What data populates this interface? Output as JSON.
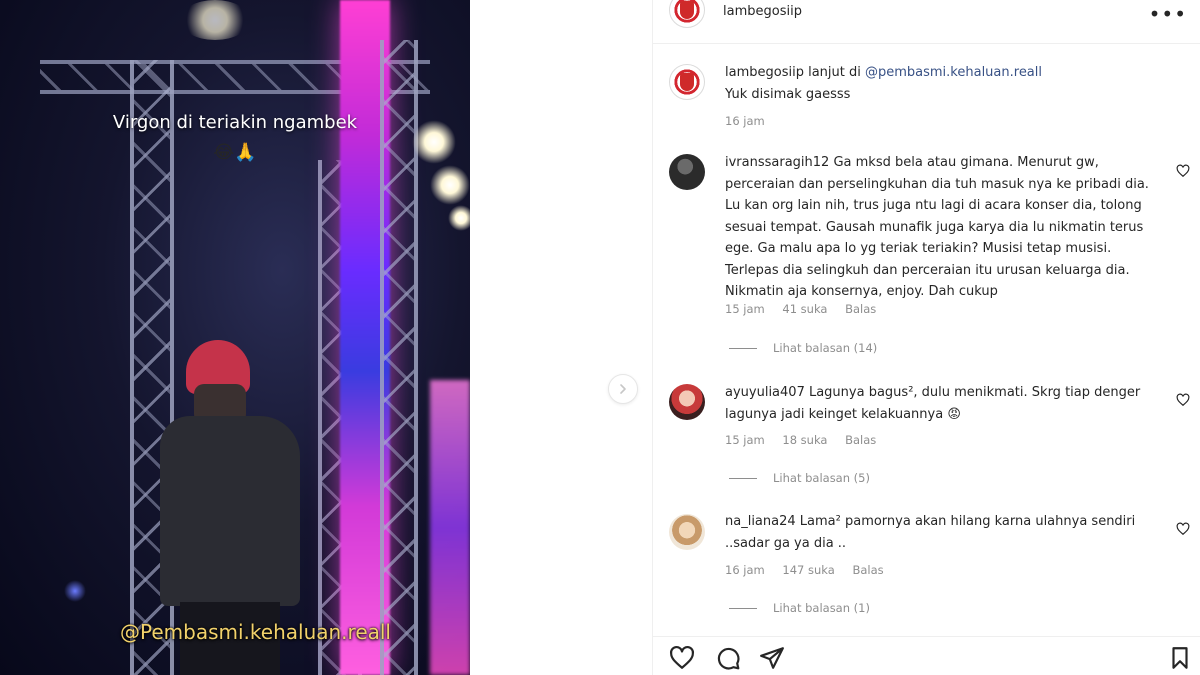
{
  "media": {
    "caption": "Virgon di teriakin ngambek",
    "caption_emoji": "😂🙏",
    "watermark": "@Pembasmi.kehaluan.reall",
    "next_icon": "chevron-right-icon"
  },
  "post": {
    "author": "lambegosiip",
    "caption_username": "lambegosiip",
    "caption_prefix": " lanjut di ",
    "caption_mention": "@pembasmi.kehaluan.reall",
    "caption_line2": "Yuk disimak gaesss",
    "caption_time": "16 jam"
  },
  "comments": [
    {
      "username": "ivranssaragih12",
      "text": " Ga mksd bela atau gimana. Menurut gw, perceraian dan perselingkuhan dia tuh masuk nya ke pribadi dia. Lu kan org lain nih, trus juga ntu lagi di acara konser dia, tolong sesuai tempat. Gausah munafik juga karya dia lu nikmatin terus ege. Ga malu apa lo yg teriak teriakin? Musisi tetap musisi. Terlepas dia selingkuh dan perceraian itu urusan keluarga dia. Nikmatin aja konsernya, enjoy. Dah cukup",
      "time": "15 jam",
      "likes": "41 suka",
      "reply": "Balas",
      "view_replies": "Lihat balasan (14)"
    },
    {
      "username": "ayuyulia407",
      "text": " Lagunya bagus², dulu menikmati. Skrg tiap denger lagunya jadi keinget kelakuannya 😡",
      "time": "15 jam",
      "likes": "18 suka",
      "reply": "Balas",
      "view_replies": "Lihat balasan (5)"
    },
    {
      "username": "na_liana24",
      "text": " Lama² pamornya akan hilang karna ulahnya sendiri ..sadar ga ya dia ..",
      "time": "16 jam",
      "likes": "147 suka",
      "reply": "Balas",
      "view_replies": "Lihat balasan (1)"
    }
  ],
  "actions": {
    "icons": [
      "heart-icon",
      "comment-icon",
      "share-icon",
      "bookmark-icon"
    ]
  },
  "colors": {
    "text": "#262626",
    "muted": "#8e8e8e",
    "mention": "#385185",
    "border": "#efefef",
    "watermark": "#f2d26b"
  }
}
